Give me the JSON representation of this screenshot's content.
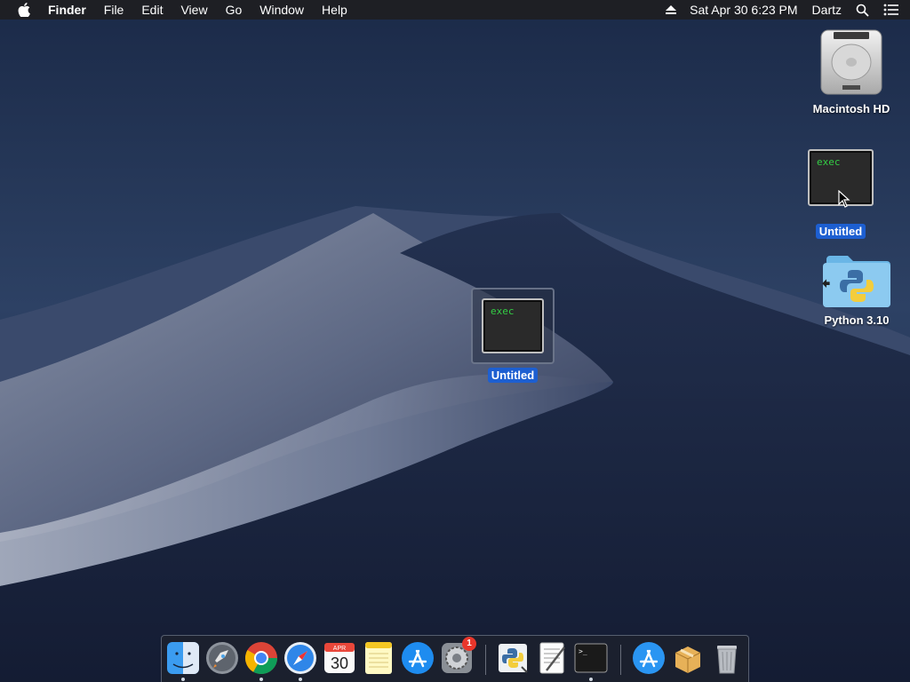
{
  "menubar": {
    "app_name": "Finder",
    "items": [
      "File",
      "Edit",
      "View",
      "Go",
      "Window",
      "Help"
    ],
    "datetime": "Sat Apr 30  6:23 PM",
    "user": "Dartz"
  },
  "desktop": {
    "icons": [
      {
        "label": "Macintosh HD",
        "icon": "hard-drive-icon"
      },
      {
        "label": "Untitled",
        "icon": "exec-document-icon",
        "thumb_text": "exec"
      },
      {
        "label": "Python 3.10",
        "icon": "python-folder-icon"
      }
    ],
    "dragged": {
      "label": "Untitled",
      "thumb_text": "exec"
    }
  },
  "dock": {
    "apps": [
      "Finder",
      "Launchpad",
      "Google Chrome",
      "Safari",
      "Calendar",
      "Notes",
      "App Store",
      "System Preferences",
      "Python Launcher",
      "TextEdit",
      "Terminal",
      "App Store",
      "Archive Utility",
      "Trash"
    ],
    "calendar": {
      "month": "APR",
      "day": "30"
    },
    "system_prefs_badge": "1"
  },
  "colors": {
    "selection": "#1d5fd1",
    "exec_text": "#33cc44",
    "badge": "#e8362b"
  }
}
